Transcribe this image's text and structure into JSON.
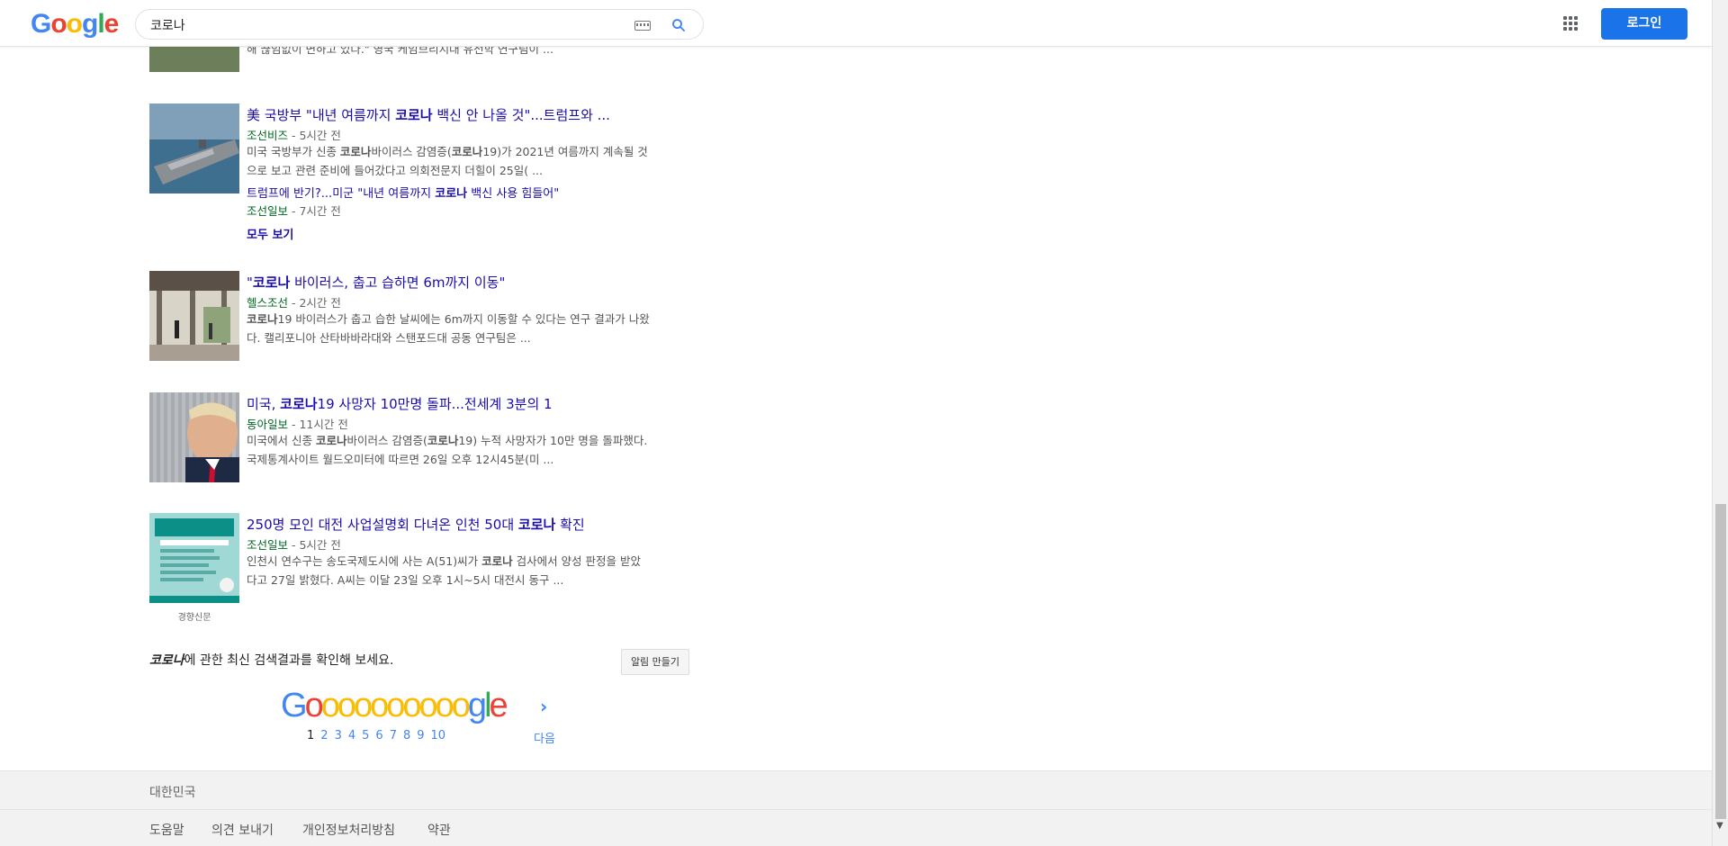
{
  "header": {
    "logo": [
      "G",
      "o",
      "o",
      "g",
      "l",
      "e"
    ],
    "search_value": "코로나",
    "login_label": "로그인"
  },
  "results": [
    {
      "snippet_partial": "해 끊임없이 변하고 있다.\" 영국 케임브리지대 유전학 연구팀이 ..."
    },
    {
      "title_pre": "美 국방부 \"내년 여름까지 ",
      "title_bold": "코로나",
      "title_post": " 백신 안 나올 것\"...트럼프와 ...",
      "source": "조선비즈",
      "time": " - 5시간 전",
      "snippet_l1_a": "미국 국방부가 신종 ",
      "snippet_l1_b": "코로나",
      "snippet_l1_c": "바이러스 감염증(",
      "snippet_l1_d": "코로나",
      "snippet_l1_e": "19)가 2021년 여름까지 계속될 것",
      "snippet_l2": "으로 보고 관련 준비에 들어갔다고 의회전문지 더힐이 25일( ...",
      "sub_title_pre": "트럼프에 반기?...미군 \"내년 여름까지 ",
      "sub_title_bold": "코로나",
      "sub_title_post": " 백신 사용 힘들어\"",
      "sub_source": "조선일보",
      "sub_time": " - 7시간 전",
      "more": "모두 보기"
    },
    {
      "title_pre": "\"",
      "title_bold": "코로나",
      "title_post": " 바이러스, 춥고 습하면 6m까지 이동\"",
      "source": "헬스조선",
      "time": " - 2시간 전",
      "snippet_l1_a": "",
      "snippet_l1_b": "코로나",
      "snippet_l1_c": "19 바이러스가 춥고 습한 날씨에는 6m까지 이동할 수 있다는 연구 결과가 나왔",
      "snippet_l2": "다. 캘리포니아 산타바바라대와 스탠포드대 공동 연구팀은 ..."
    },
    {
      "title_pre": "미국, ",
      "title_bold": "코로나",
      "title_post": "19 사망자 10만명 돌파...전세계 3분의 1",
      "source": "동아일보",
      "time": " - 11시간 전",
      "snippet_l1_a": "미국에서 신종 ",
      "snippet_l1_b": "코로나",
      "snippet_l1_c": "바이러스 감염증(",
      "snippet_l1_d": "코로나",
      "snippet_l1_e": "19) 누적 사망자가 10만 명을 돌파했다.",
      "snippet_l2": "국제통계사이트 월드오미터에 따르면 26일 오후 12시45분(미 ..."
    },
    {
      "title_pre": "250명 모인 대전 사업설명회 다녀온 인천 50대 ",
      "title_bold": "코로나",
      "title_post": " 확진",
      "source": "조선일보",
      "time": " - 5시간 전",
      "snippet_l1_a": "인천시 연수구는 송도국제도시에 사는 A(51)씨가 ",
      "snippet_l1_b": "코로나",
      "snippet_l1_c": " 검사에서 양성 판정을 받았",
      "snippet_l2": "다고 27일 밝혔다. A씨는 이달 23일 오후 1시~5시 대전시 동구 ...",
      "image_caption": "경향신문"
    }
  ],
  "alert": {
    "query_italic": "코로나",
    "text": "에 관한 최신 검색결과를 확인해 보세요.",
    "button": "알림 만들기"
  },
  "pager": {
    "pages": [
      "1",
      "2",
      "3",
      "4",
      "5",
      "6",
      "7",
      "8",
      "9",
      "10"
    ],
    "next_label": "다음"
  },
  "footer": {
    "region": "대한민국",
    "links": [
      "도움말",
      "의견 보내기",
      "개인정보처리방침",
      "약관"
    ]
  }
}
